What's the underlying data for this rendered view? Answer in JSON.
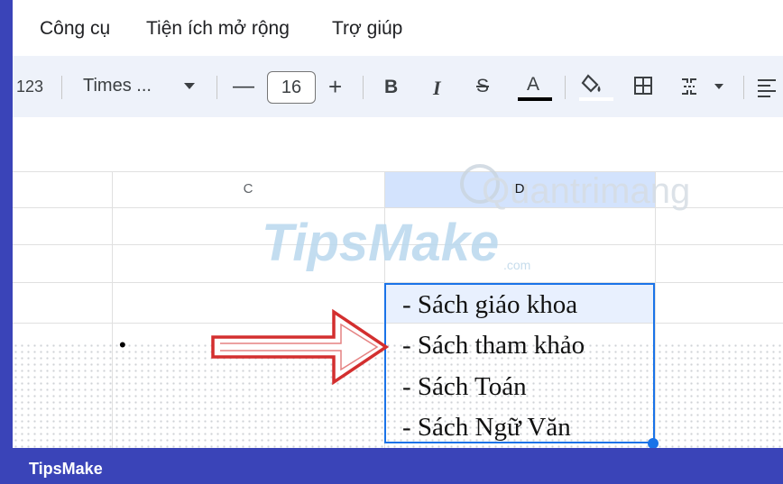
{
  "menu": {
    "items": [
      "Công cụ",
      "Tiện ích mở rộng",
      "Trợ giúp"
    ]
  },
  "toolbar": {
    "number_format": "123",
    "font_name": "Times ...",
    "font_size": "16",
    "decrease_label": "—",
    "increase_label": "+",
    "bold_label": "B",
    "italic_label": "I",
    "strikethrough_label": "S",
    "text_color_label": "A"
  },
  "sheet": {
    "columns": [
      "C",
      "D"
    ],
    "cells": [
      "- Sách giáo khoa",
      "- Sách tham khảo",
      "- Sách Toán",
      "- Sách Ngữ Văn"
    ],
    "bullet": "•"
  },
  "watermarks": {
    "tipsmake": "TipsMake",
    "tipsmake_domain": ".com",
    "quantrimang": "Quantrimang"
  },
  "footer": {
    "brand": "TipsMake"
  },
  "colors": {
    "frame": "#3a44b8",
    "toolbar_bg": "#eef2fa",
    "selection_fill": "#e8f0fe",
    "selection_border": "#1a73e8",
    "arrow": "#d32f2f"
  }
}
